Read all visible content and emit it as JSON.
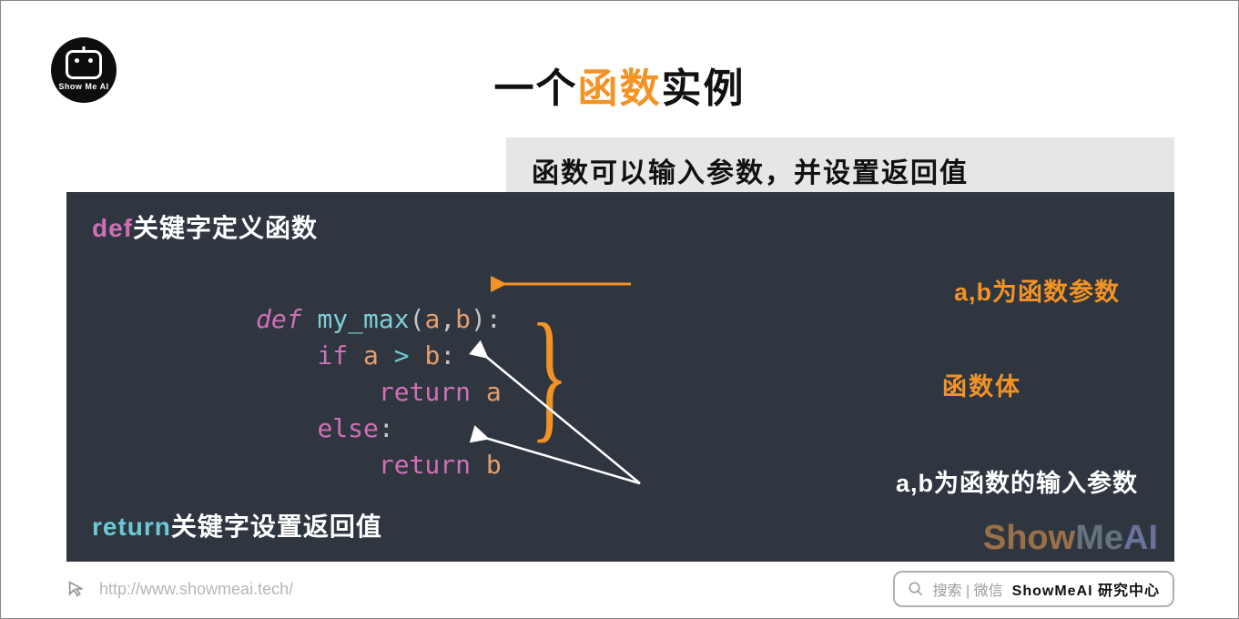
{
  "logo_text": "Show Me AI",
  "title": {
    "pre": "一个",
    "hl": "函数",
    "post": "实例"
  },
  "subtitle": "函数可以输入参数，并设置返回值",
  "def_label": {
    "kw": "def",
    "rest": "关键字定义函数"
  },
  "ret_label": {
    "kw": "return",
    "rest": "关键字设置返回值"
  },
  "code": {
    "l1": {
      "def": "def ",
      "fn": "my_max",
      "lp": "(",
      "a": "a",
      "c1": ",",
      "b": "b",
      "rp": ")",
      "colon": ":"
    },
    "l2": {
      "indent": "    ",
      "if": "if ",
      "a": "a",
      " op": " > ",
      "opv": ">",
      "sp": " ",
      "b": "b",
      "colon": ":"
    },
    "l3": {
      "indent": "        ",
      "ret": "return ",
      "a": "a"
    },
    "l4": {
      "indent": "    ",
      "else": "else",
      "colon": ":"
    },
    "l5": {
      "indent": "        ",
      "ret": "return ",
      "b": "b"
    }
  },
  "ann": {
    "params": "a,b为函数参数",
    "body": "函数体",
    "input": "a,b为函数的输入参数"
  },
  "watermark": {
    "p1": "Show",
    "p2": "Me",
    "p3": "AI"
  },
  "footer": {
    "url": "http://www.showmeai.tech/",
    "search_label": "搜索 | 微信",
    "brand": "ShowMeAI 研究中心"
  }
}
